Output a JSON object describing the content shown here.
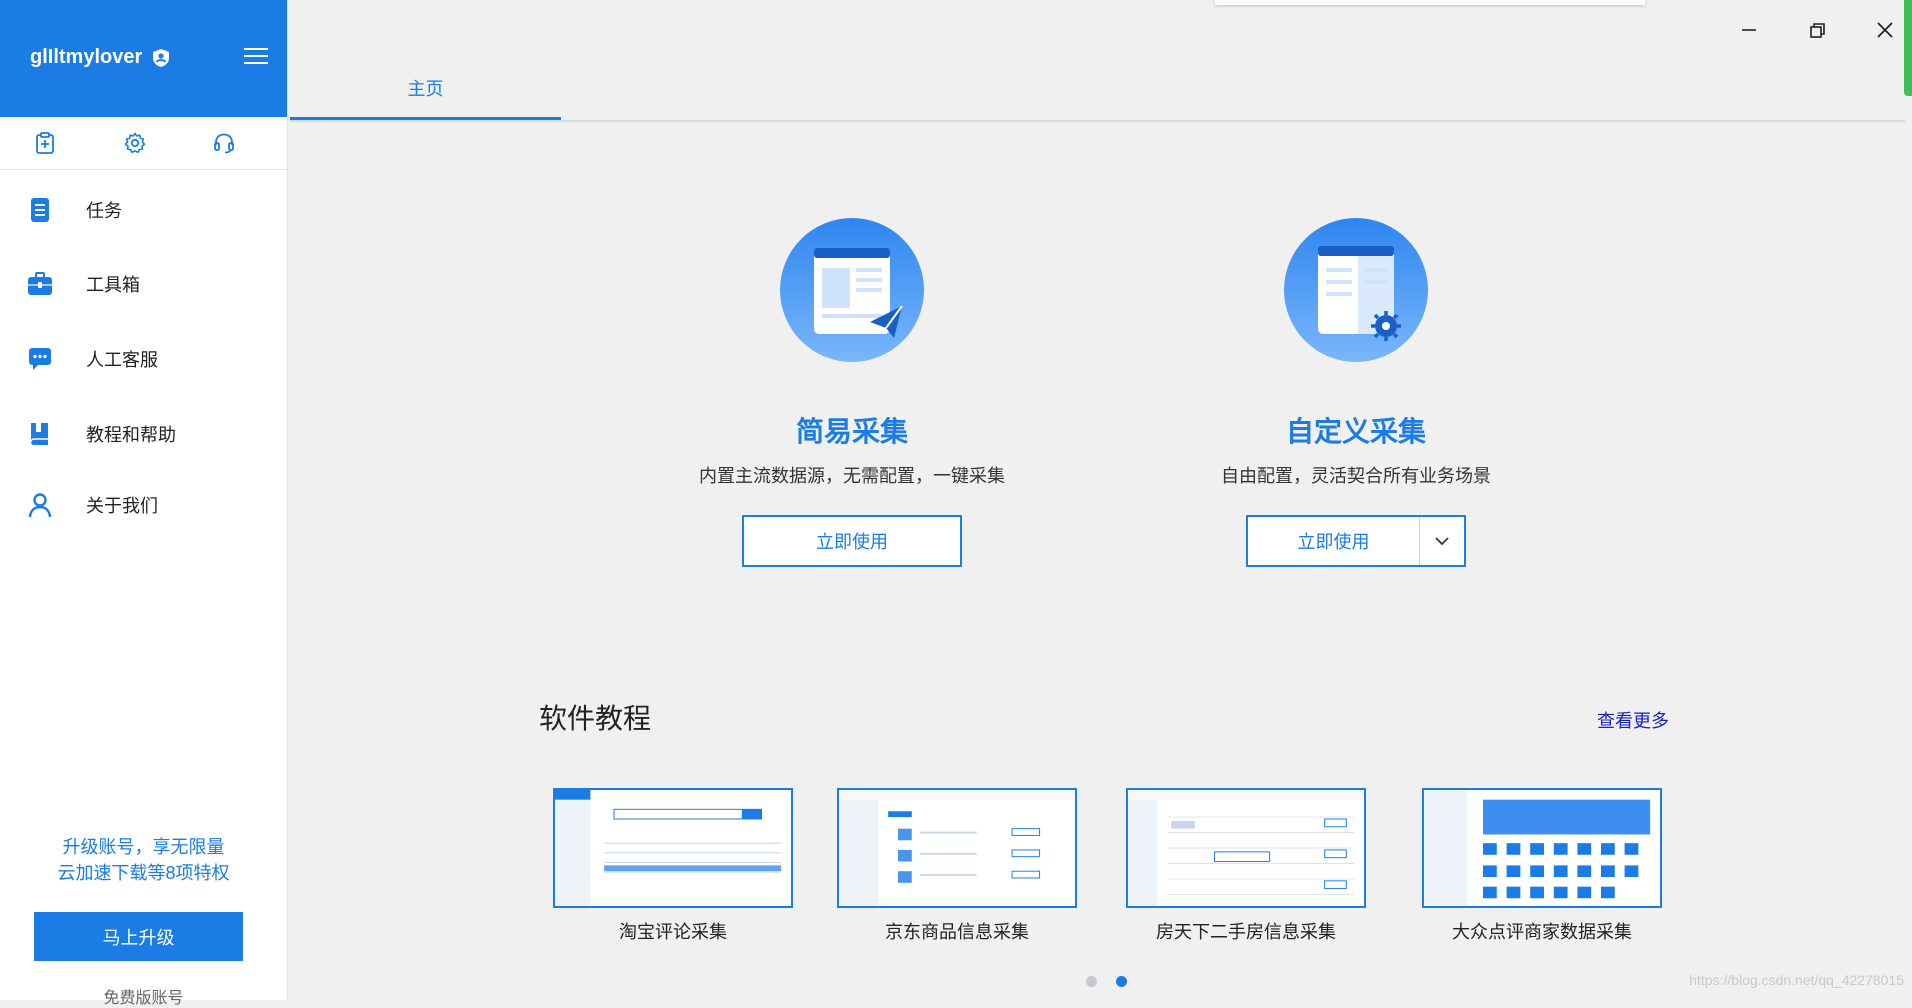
{
  "sidebar": {
    "username": "glIltmylover",
    "quick_icons": [
      "clipboard-plus-icon",
      "gear-icon",
      "headset-icon"
    ],
    "items": [
      {
        "label": "任务",
        "icon": "task-doc-icon"
      },
      {
        "label": "工具箱",
        "icon": "toolbox-icon"
      },
      {
        "label": "人工客服",
        "icon": "chat-bubble-icon"
      },
      {
        "label": "教程和帮助",
        "icon": "book-icon"
      },
      {
        "label": "关于我们",
        "icon": "user-icon"
      }
    ],
    "promo_line1": "升级账号，享无限量",
    "promo_line2": "云加速下载等8项特权",
    "upgrade_label": "马上升级",
    "account_type": "免费版账号"
  },
  "tabs": {
    "home": "主页"
  },
  "features": {
    "simple": {
      "title": "简易采集",
      "desc": "内置主流数据源，无需配置，一键采集",
      "button": "立即使用"
    },
    "custom": {
      "title": "自定义采集",
      "desc": "自由配置，灵活契合所有业务场景",
      "button": "立即使用"
    }
  },
  "tutorials": {
    "title": "软件教程",
    "more": "查看更多",
    "items": [
      {
        "label": "淘宝评论采集"
      },
      {
        "label": "京东商品信息采集"
      },
      {
        "label": "房天下二手房信息采集"
      },
      {
        "label": "大众点评商家数据采集"
      }
    ],
    "pages": 2,
    "current_page": 2
  },
  "watermark": "https://blog.csdn.net/qq_42278015",
  "colors": {
    "accent": "#1a7ce4",
    "link": "#1520c8",
    "background": "#f0f0f0"
  }
}
